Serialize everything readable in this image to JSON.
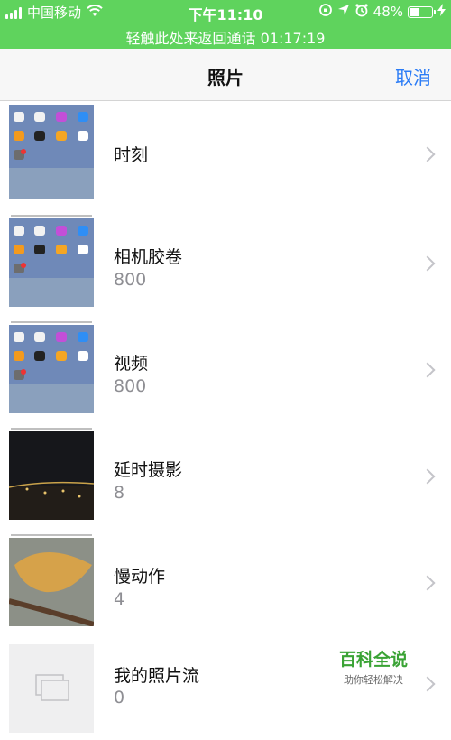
{
  "status_bar": {
    "carrier": "中国移动",
    "time": "下午11:10",
    "battery": "48%",
    "battery_level": 0.48,
    "call_banner": "轻触此处来返回通话 01:17:19"
  },
  "nav": {
    "title": "照片",
    "cancel": "取消"
  },
  "albums": [
    {
      "title": "时刻",
      "count": ""
    },
    {
      "title": "相机胶卷",
      "count": "800"
    },
    {
      "title": "视频",
      "count": "800"
    },
    {
      "title": "延时摄影",
      "count": "8"
    },
    {
      "title": "慢动作",
      "count": "4"
    },
    {
      "title": "我的照片流",
      "count": "0"
    }
  ],
  "watermark": {
    "title": "百科全说",
    "subtitle": "助你轻松解决"
  },
  "colors": {
    "status_green": "#5fd35d",
    "accent_blue": "#2b7cf6",
    "watermark_green": "#3aa335"
  }
}
